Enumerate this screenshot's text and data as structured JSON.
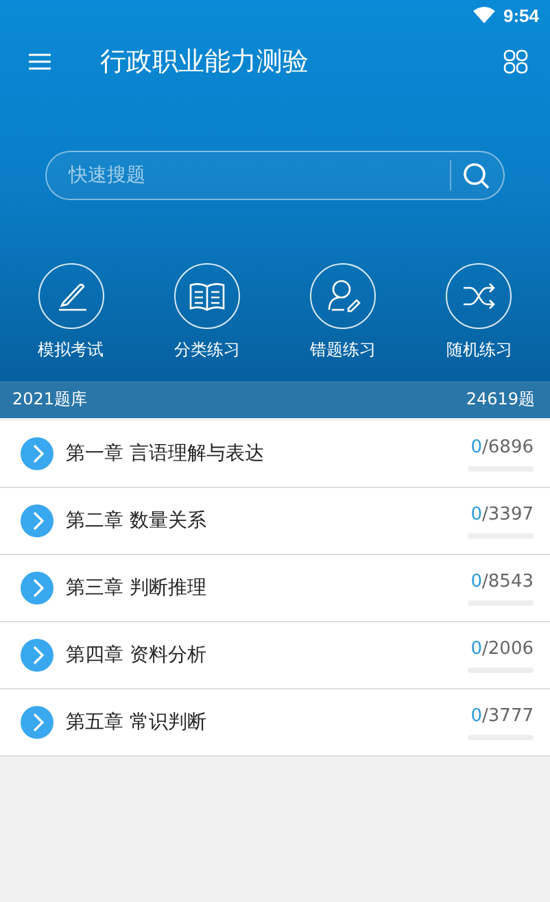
{
  "status_bar": {
    "time": "9:54"
  },
  "app_bar": {
    "title": "行政职业能力测验"
  },
  "search": {
    "placeholder": "快速搜题"
  },
  "shortcuts": [
    {
      "kind": "pen",
      "label": "模拟考试"
    },
    {
      "kind": "book",
      "label": "分类练习"
    },
    {
      "kind": "person",
      "label": "错题练习"
    },
    {
      "kind": "shuffle",
      "label": "随机练习"
    }
  ],
  "bank": {
    "name": "2021题库",
    "count": "24619题"
  },
  "chapters": [
    {
      "title": "第一章 言语理解与表达",
      "done": "0",
      "total": "/6896",
      "level": 0
    },
    {
      "title": "第二章 数量关系",
      "done": "0",
      "total": "/3397",
      "level": 0
    },
    {
      "title": "第三章 判断推理",
      "done": "0",
      "total": "/8543",
      "level": 0
    },
    {
      "title": "第四章 资料分析",
      "done": "0",
      "total": "/2006",
      "level": 0
    },
    {
      "title": "第五章 常识判断",
      "done": "0",
      "total": "/3777",
      "level": 0
    }
  ]
}
